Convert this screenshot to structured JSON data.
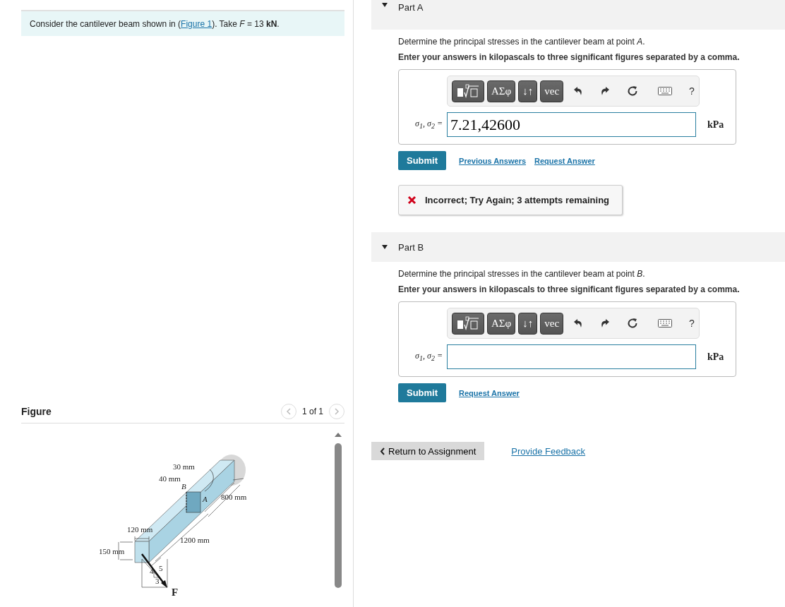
{
  "problem": {
    "before": "Consider the cantilever beam shown in (",
    "link": "Figure 1",
    "after": "). Take *F* = 13 **kN**."
  },
  "figure": {
    "heading": "Figure",
    "pager": "1 of 1",
    "labels": [
      "30 mm",
      "40 mm",
      "B",
      "A",
      "800 mm",
      "120 mm",
      "1200 mm",
      "150 mm",
      "4",
      "5",
      "3",
      "F"
    ]
  },
  "parts": [
    {
      "title": "Part A",
      "expanded": true,
      "prompt": "Determine the principal stresses in the cantilever beam at point *A*.",
      "instruction": "Enter your answers in kilopascals to three significant figures separated by a comma.",
      "toolbar": {
        "buttons": [
          {
            "kind": "template"
          },
          {
            "kind": "label",
            "label": "ΑΣφ"
          },
          {
            "kind": "label",
            "label": "↓↑"
          },
          {
            "kind": "label",
            "label": "vec"
          }
        ],
        "help": "?"
      },
      "variable": "σ$_{1}$, σ$_{2}$ =",
      "value": "7.21,42600",
      "unit": "kPa",
      "submit": "Submit",
      "links": [
        "Previous Answers",
        "Request Answer"
      ],
      "feedback": "Incorrect; Try Again; 3 attempts remaining"
    },
    {
      "title": "Part B",
      "expanded": true,
      "prompt": "Determine the principal stresses in the cantilever beam at point *B*.",
      "instruction": "Enter your answers in kilopascals to three significant figures separated by a comma.",
      "toolbar": {
        "buttons": [
          {
            "kind": "template"
          },
          {
            "kind": "label",
            "label": "ΑΣφ"
          },
          {
            "kind": "label",
            "label": "↓↑"
          },
          {
            "kind": "label",
            "label": "vec"
          }
        ],
        "help": "?"
      },
      "variable": "σ$_{1}$, σ$_{2}$ =",
      "unit": "kPa",
      "submit": "Submit",
      "links": [
        "Request Answer"
      ]
    }
  ],
  "footer": {
    "back": "Return to Assignment",
    "feedback_link": "Provide Feedback"
  }
}
